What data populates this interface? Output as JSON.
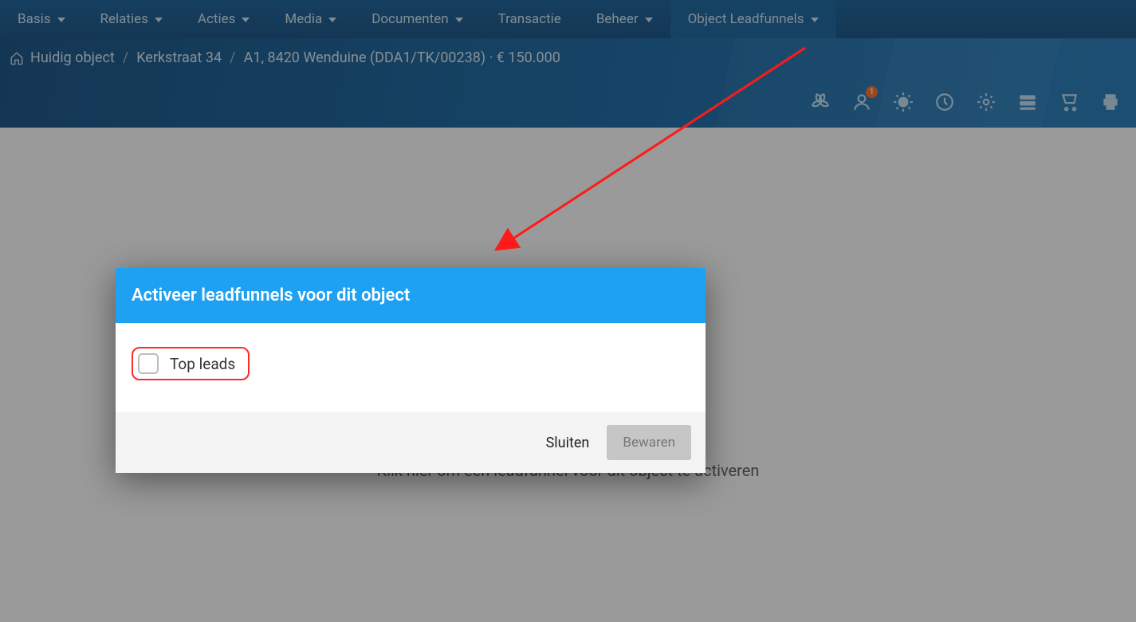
{
  "nav": {
    "items": [
      {
        "label": "Basis",
        "dropdown": true
      },
      {
        "label": "Relaties",
        "dropdown": true
      },
      {
        "label": "Acties",
        "dropdown": true
      },
      {
        "label": "Media",
        "dropdown": true
      },
      {
        "label": "Documenten",
        "dropdown": true
      },
      {
        "label": "Transactie",
        "dropdown": false
      },
      {
        "label": "Beheer",
        "dropdown": true
      },
      {
        "label": "Object Leadfunnels",
        "dropdown": true,
        "active": true
      }
    ]
  },
  "breadcrumb": {
    "root": "Huidig object",
    "street": "Kerkstraat 34",
    "detail": "A1, 8420 Wenduine (DDA1/TK/00238) · € 150.000"
  },
  "toolbar": {
    "badge_count": "1"
  },
  "main": {
    "hint": "Klik hier om een leadfunnel voor dit object te activeren"
  },
  "dialog": {
    "title": "Activeer leadfunnels voor dit object",
    "option_label": "Top leads",
    "close_label": "Sluiten",
    "save_label": "Bewaren"
  }
}
